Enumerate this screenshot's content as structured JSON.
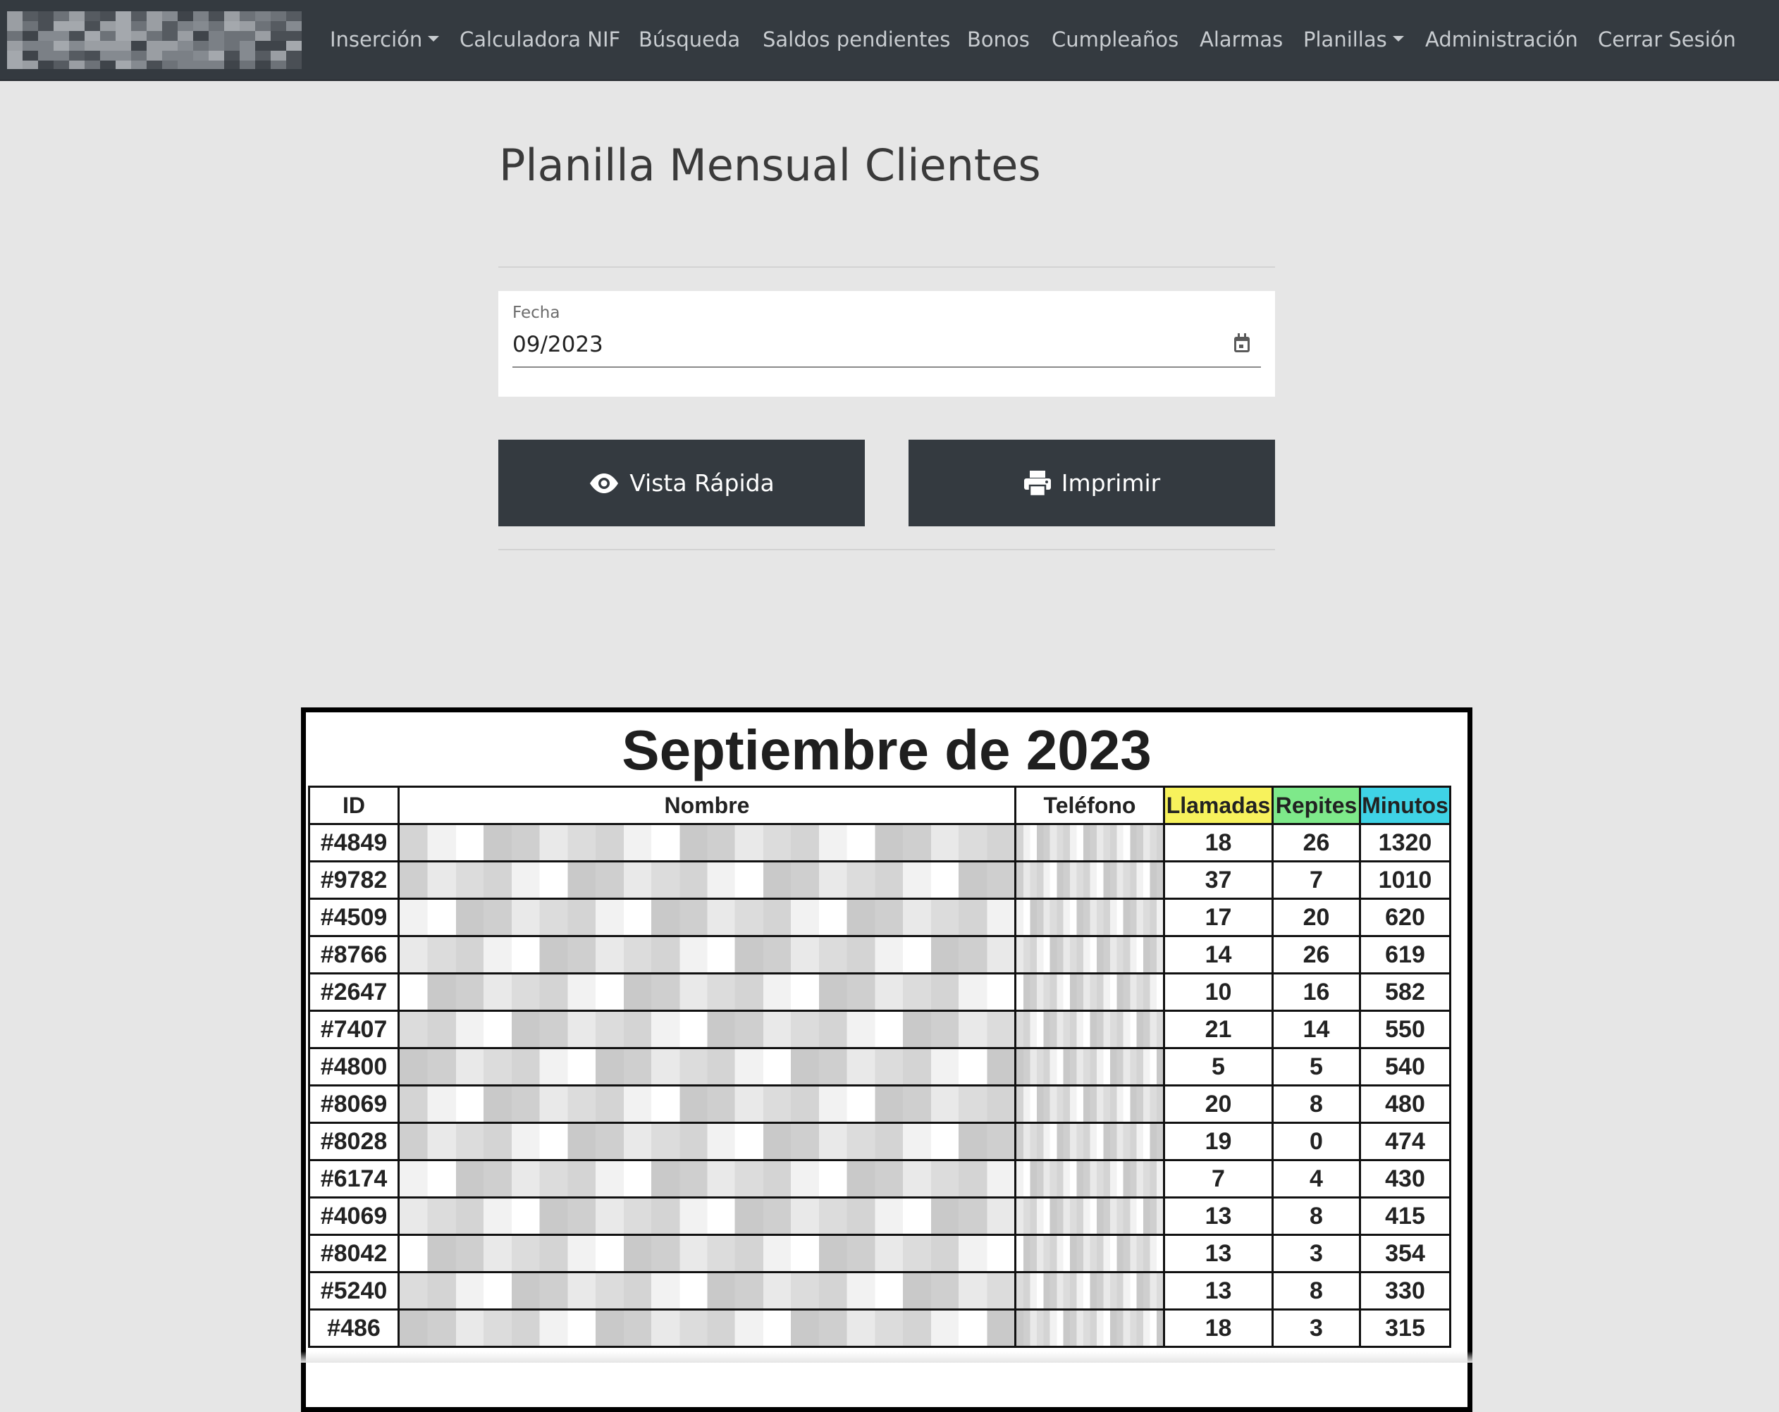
{
  "colors": {
    "navbar_bg": "#343a40",
    "page_bg": "#e6e6e6",
    "button_bg": "#343a40",
    "header_llamadas": "#f7f25c",
    "header_repites": "#7ee98a",
    "header_minutos": "#3fd3e6"
  },
  "navbar": {
    "logo_icon": "pixelated-logo",
    "items": [
      {
        "label": "Inserción",
        "dropdown": true
      },
      {
        "label": "Calculadora NIF"
      },
      {
        "label": "Búsqueda"
      },
      {
        "label": "Saldos pendientes"
      },
      {
        "label": "Bonos"
      },
      {
        "label": "Cumpleaños"
      },
      {
        "label": "Alarmas"
      },
      {
        "label": "Planillas",
        "dropdown": true
      },
      {
        "label": "Administración"
      },
      {
        "label": "Cerrar Sesión"
      }
    ]
  },
  "page": {
    "title": "Planilla Mensual Clientes"
  },
  "date_field": {
    "label": "Fecha",
    "value": "09/2023",
    "icon": "calendar-icon"
  },
  "buttons": {
    "quick_view": {
      "label": "Vista Rápida",
      "icon": "eye-icon"
    },
    "print": {
      "label": "Imprimir",
      "icon": "printer-icon"
    }
  },
  "report": {
    "title": "Septiembre de 2023",
    "headers": {
      "id": "ID",
      "nombre": "Nombre",
      "telefono": "Teléfono",
      "llamadas": "Llamadas",
      "repites": "Repites",
      "minutos": "Minutos"
    },
    "rows": [
      {
        "id": "#4849",
        "llamadas": "18",
        "repites": "26",
        "minutos": "1320"
      },
      {
        "id": "#9782",
        "llamadas": "37",
        "repites": "7",
        "minutos": "1010"
      },
      {
        "id": "#4509",
        "llamadas": "17",
        "repites": "20",
        "minutos": "620"
      },
      {
        "id": "#8766",
        "llamadas": "14",
        "repites": "26",
        "minutos": "619"
      },
      {
        "id": "#2647",
        "llamadas": "10",
        "repites": "16",
        "minutos": "582"
      },
      {
        "id": "#7407",
        "llamadas": "21",
        "repites": "14",
        "minutos": "550"
      },
      {
        "id": "#4800",
        "llamadas": "5",
        "repites": "5",
        "minutos": "540"
      },
      {
        "id": "#8069",
        "llamadas": "20",
        "repites": "8",
        "minutos": "480"
      },
      {
        "id": "#8028",
        "llamadas": "19",
        "repites": "0",
        "minutos": "474"
      },
      {
        "id": "#6174",
        "llamadas": "7",
        "repites": "4",
        "minutos": "430"
      },
      {
        "id": "#4069",
        "llamadas": "13",
        "repites": "8",
        "minutos": "415"
      },
      {
        "id": "#8042",
        "llamadas": "13",
        "repites": "3",
        "minutos": "354"
      },
      {
        "id": "#5240",
        "llamadas": "13",
        "repites": "8",
        "minutos": "330"
      },
      {
        "id": "#486",
        "llamadas": "18",
        "repites": "3",
        "minutos": "315"
      }
    ]
  }
}
